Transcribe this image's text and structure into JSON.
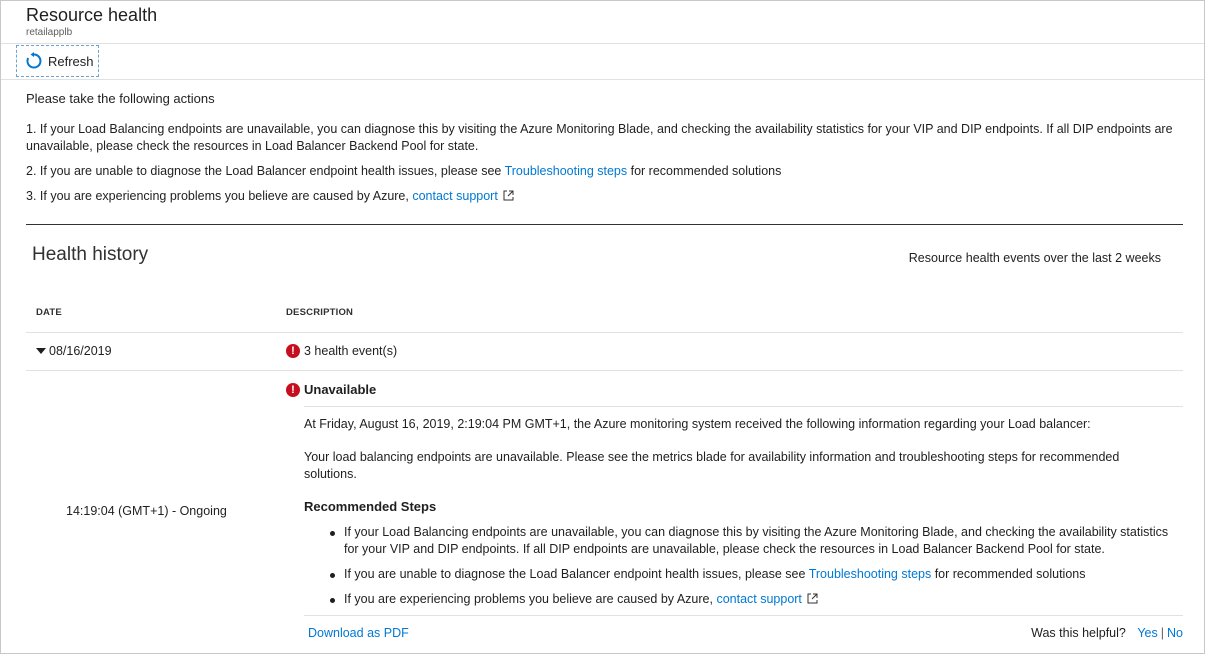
{
  "header": {
    "title": "Resource health",
    "subtitle": "retailapplb"
  },
  "toolbar": {
    "refresh_label": "Refresh",
    "refresh_icon": "refresh-icon"
  },
  "actions": {
    "intro": "Please take the following actions",
    "item1_text": "1.  If your Load Balancing endpoints are unavailable, you can diagnose this by visiting the Azure Monitoring Blade, and checking the availability statistics for your VIP and DIP endpoints. If all DIP endpoints are unavailable, please check the resources in Load Balancer Backend Pool for state.",
    "item2_prefix": "2.  If you are unable to diagnose the Load Balancer endpoint health issues, please see ",
    "item2_link": "Troubleshooting steps",
    "item2_suffix": " for recommended solutions",
    "item3_prefix": "3.  If you are experiencing problems you believe are caused by Azure, ",
    "item3_link": "contact support"
  },
  "history": {
    "title": "Health history",
    "note": "Resource health events over the last 2 weeks",
    "col_date": "DATE",
    "col_description": "DESCRIPTION",
    "row": {
      "date": "08/16/2019",
      "summary": "3 health event(s)"
    },
    "detail": {
      "status": "Unavailable",
      "message": "At Friday, August 16, 2019, 2:19:04 PM GMT+1, the Azure monitoring system received the following information regarding your Load balancer:",
      "body": "Your load balancing endpoints are unavailable. Please see the metrics blade for availability information and troubleshooting steps for recommended solutions.",
      "time": "14:19:04 (GMT+1) - Ongoing",
      "steps_title": "Recommended Steps",
      "step1": "If your Load Balancing endpoints are unavailable, you can diagnose this by visiting the Azure Monitoring Blade, and checking the availability statistics for your VIP and DIP endpoints. If all DIP endpoints are unavailable, please check the resources in Load Balancer Backend Pool for state.",
      "step2_prefix": "If you are unable to diagnose the Load Balancer endpoint health issues, please see ",
      "step2_link": "Troubleshooting steps",
      "step2_suffix": " for recommended solutions",
      "step3_prefix": "If you are experiencing problems you believe are caused by Azure, ",
      "step3_link": "contact support",
      "download_label": "Download as PDF",
      "helpful_label": "Was this helpful?",
      "yes_label": "Yes",
      "separator": "|",
      "no_label": "No"
    }
  },
  "colors": {
    "link": "#0078d4",
    "error": "#c50f1f",
    "refresh_icon": "#0078d4"
  }
}
